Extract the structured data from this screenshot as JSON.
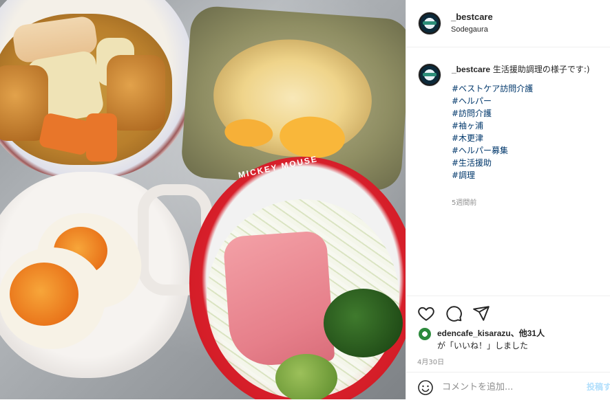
{
  "post": {
    "photo_alt": "",
    "rim_text": "MICKEY MOUSE"
  },
  "header": {
    "username": "_bestcare",
    "location": "Sodegaura"
  },
  "caption": {
    "username": "_bestcare",
    "text": "生活援助調理の様子です:)",
    "hashtags": [
      "#ベストケア訪問介護",
      "#ヘルパー",
      "#訪問介護",
      "#袖ヶ浦",
      "#木更津",
      "#ヘルパー募集",
      "#生活援助",
      "#調理"
    ],
    "time_ago": "5週間前"
  },
  "actions": {
    "icons": [
      "heart-icon",
      "comment-icon",
      "share-icon"
    ]
  },
  "likes": {
    "line1": "edencafe_kisarazu、他31人",
    "line2": "が「いいね！」しました"
  },
  "date": "4月30日",
  "comment": {
    "placeholder": "コメントを追加...",
    "post_label": "投稿する"
  },
  "colors": {
    "link": "#00376b",
    "muted": "#8e8e8e",
    "post_disabled": "#b2dffc"
  }
}
